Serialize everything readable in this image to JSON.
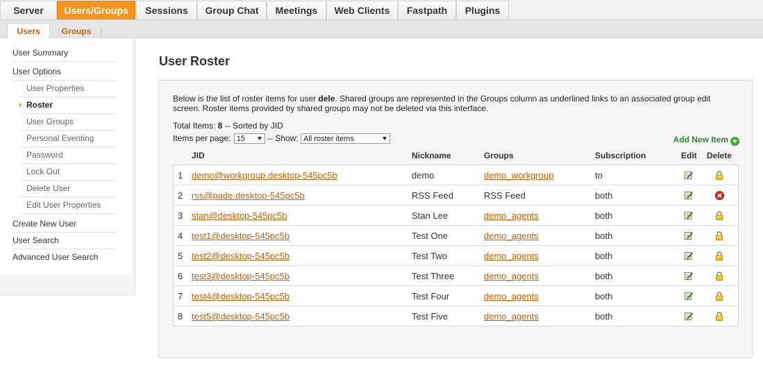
{
  "nav": {
    "tabs": [
      "Server",
      "Users/Groups",
      "Sessions",
      "Group Chat",
      "Meetings",
      "Web Clients",
      "Fastpath",
      "Plugins"
    ],
    "active_tab": "Users/Groups",
    "subtabs": [
      "Users",
      "Groups"
    ],
    "active_subtab": "Users"
  },
  "sidebar": {
    "items": [
      {
        "label": "User Summary"
      },
      {
        "label": "User Options"
      },
      {
        "label": "User Properties"
      },
      {
        "label": "Roster"
      },
      {
        "label": "User Groups"
      },
      {
        "label": "Personal Eventing"
      },
      {
        "label": "Password"
      },
      {
        "label": "Lock Out"
      },
      {
        "label": "Delete User"
      },
      {
        "label": "Edit User Properties"
      },
      {
        "label": "Create New User"
      },
      {
        "label": "User Search"
      },
      {
        "label": "Advanced User Search"
      }
    ]
  },
  "main": {
    "title": "User Roster",
    "intro_before": "Below is the list of roster items for user ",
    "username": "dele",
    "intro_after": ". Shared groups are represented in the Groups column as underlined links to an associated group edit screen. Roster items provided by shared groups may not be deleted via this interface.",
    "total_label": "Total Items: ",
    "total_count": "8",
    "sorted_by": " -- Sorted by JID",
    "items_per_page_label": "Items per page:",
    "items_per_page": "15",
    "show_label": "-- Show:",
    "show_value": "All roster items",
    "add_new_label": "Add New Item"
  },
  "table": {
    "columns": [
      "JID",
      "Nickname",
      "Groups",
      "Subscription",
      "Edit",
      "Delete"
    ],
    "rows": [
      {
        "num": "1",
        "jid": "demo@workgroup.desktop-545pc5b",
        "nickname": "demo",
        "group": "demo_workgroup",
        "group_link": true,
        "subscription": "to",
        "delete": "lock"
      },
      {
        "num": "2",
        "jid": "rss@pade.desktop-545pc5b",
        "nickname": "RSS Feed",
        "group": "RSS Feed",
        "group_link": false,
        "subscription": "both",
        "delete": "remove"
      },
      {
        "num": "3",
        "jid": "stan@desktop-545pc5b",
        "nickname": "Stan Lee",
        "group": "demo_agents",
        "group_link": true,
        "subscription": "both",
        "delete": "lock"
      },
      {
        "num": "4",
        "jid": "test1@desktop-545pc5b",
        "nickname": "Test One",
        "group": "demo_agents",
        "group_link": true,
        "subscription": "both",
        "delete": "lock"
      },
      {
        "num": "5",
        "jid": "test2@desktop-545pc5b",
        "nickname": "Test Two",
        "group": "demo_agents",
        "group_link": true,
        "subscription": "both",
        "delete": "lock"
      },
      {
        "num": "6",
        "jid": "test3@desktop-545pc5b",
        "nickname": "Test Three",
        "group": "demo_agents",
        "group_link": true,
        "subscription": "both",
        "delete": "lock"
      },
      {
        "num": "7",
        "jid": "test4@desktop-545pc5b",
        "nickname": "Test Four",
        "group": "demo_agents",
        "group_link": true,
        "subscription": "both",
        "delete": "lock"
      },
      {
        "num": "8",
        "jid": "test5@desktop-545pc5b",
        "nickname": "Test Five",
        "group": "demo_agents",
        "group_link": true,
        "subscription": "both",
        "delete": "lock"
      }
    ]
  },
  "colors": {
    "accent": "#f4961e",
    "link": "#cc5f00",
    "add_green": "#2f8a2f"
  }
}
